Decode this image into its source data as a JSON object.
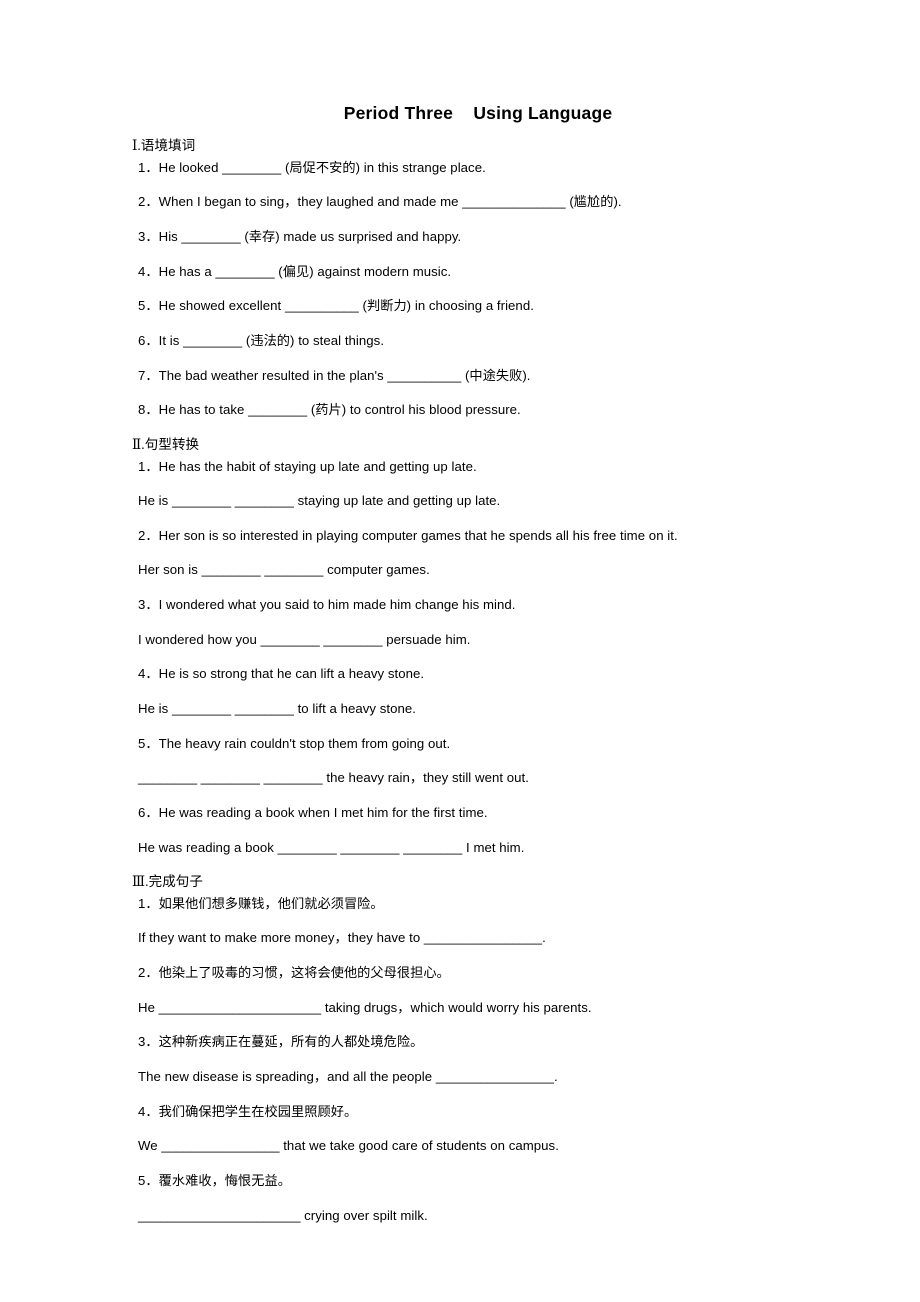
{
  "document": {
    "title": "Period Three    Using Language",
    "sections": [
      {
        "id": "section-1",
        "heading": "Ⅰ.语境填词",
        "lines": [
          {
            "type": "numbered",
            "text": "1．He looked ________ (局促不安的) in this strange place."
          },
          {
            "type": "numbered",
            "text": "2．When I began to sing，they laughed and made me ______________ (尴尬的)."
          },
          {
            "type": "numbered",
            "text": "3．His ________ (幸存) made us surprised and happy."
          },
          {
            "type": "numbered",
            "text": "4．He has a ________ (偏见) against modern music."
          },
          {
            "type": "numbered",
            "text": "5．He showed excellent __________ (判断力) in choosing a friend."
          },
          {
            "type": "numbered",
            "text": "6．It is ________ (违法的) to steal things."
          },
          {
            "type": "numbered",
            "text": "7．The bad weather resulted in the plan's __________ (中途失败)."
          },
          {
            "type": "numbered",
            "text": "8．He has to take ________ (药片) to control his blood pressure."
          }
        ]
      },
      {
        "id": "section-2",
        "heading": "Ⅱ.句型转换",
        "lines": [
          {
            "type": "numbered",
            "text": "1．He has the habit of staying up late and getting up late."
          },
          {
            "type": "answer",
            "text": "He is ________ ________ staying up late and getting up late."
          },
          {
            "type": "numbered",
            "text": "2．Her son is so interested in playing computer games that he spends all his free time on it."
          },
          {
            "type": "answer",
            "text": "Her son is ________ ________ computer games."
          },
          {
            "type": "numbered",
            "text": "3．I wondered what you said to him made him change his mind."
          },
          {
            "type": "answer",
            "text": "I wondered how you ________ ________ persuade him."
          },
          {
            "type": "numbered",
            "text": "4．He is so strong that he can lift a heavy stone."
          },
          {
            "type": "answer",
            "text": "He is ________ ________ to lift a heavy stone."
          },
          {
            "type": "numbered",
            "text": "5．The heavy rain couldn't stop them from going out."
          },
          {
            "type": "answer",
            "text": "________ ________ ________ the heavy rain，they still went out."
          },
          {
            "type": "numbered",
            "text": "6．He was reading a book when I met him for the first time."
          },
          {
            "type": "answer",
            "text": "He was reading a book ________ ________ ________ I met him."
          }
        ]
      },
      {
        "id": "section-3",
        "heading": "Ⅲ.完成句子",
        "lines": [
          {
            "type": "numbered",
            "text": "1．如果他们想多赚钱，他们就必须冒险。"
          },
          {
            "type": "answer",
            "text": "If they want to make more money，they have to ________________."
          },
          {
            "type": "numbered",
            "text": "2．他染上了吸毒的习惯，这将会使他的父母很担心。"
          },
          {
            "type": "answer",
            "text": "He ______________________ taking drugs，which would worry his parents."
          },
          {
            "type": "numbered",
            "text": "3．这种新疾病正在蔓延，所有的人都处境危险。"
          },
          {
            "type": "answer",
            "text": "The new disease is spreading，and all the people ________________."
          },
          {
            "type": "numbered",
            "text": "4．我们确保把学生在校园里照顾好。"
          },
          {
            "type": "answer",
            "text": "We ________________ that we take good care of students on campus."
          },
          {
            "type": "numbered",
            "text": "5．覆水难收，悔恨无益。"
          },
          {
            "type": "answer",
            "text": "______________________ crying over spilt milk."
          }
        ]
      }
    ]
  }
}
